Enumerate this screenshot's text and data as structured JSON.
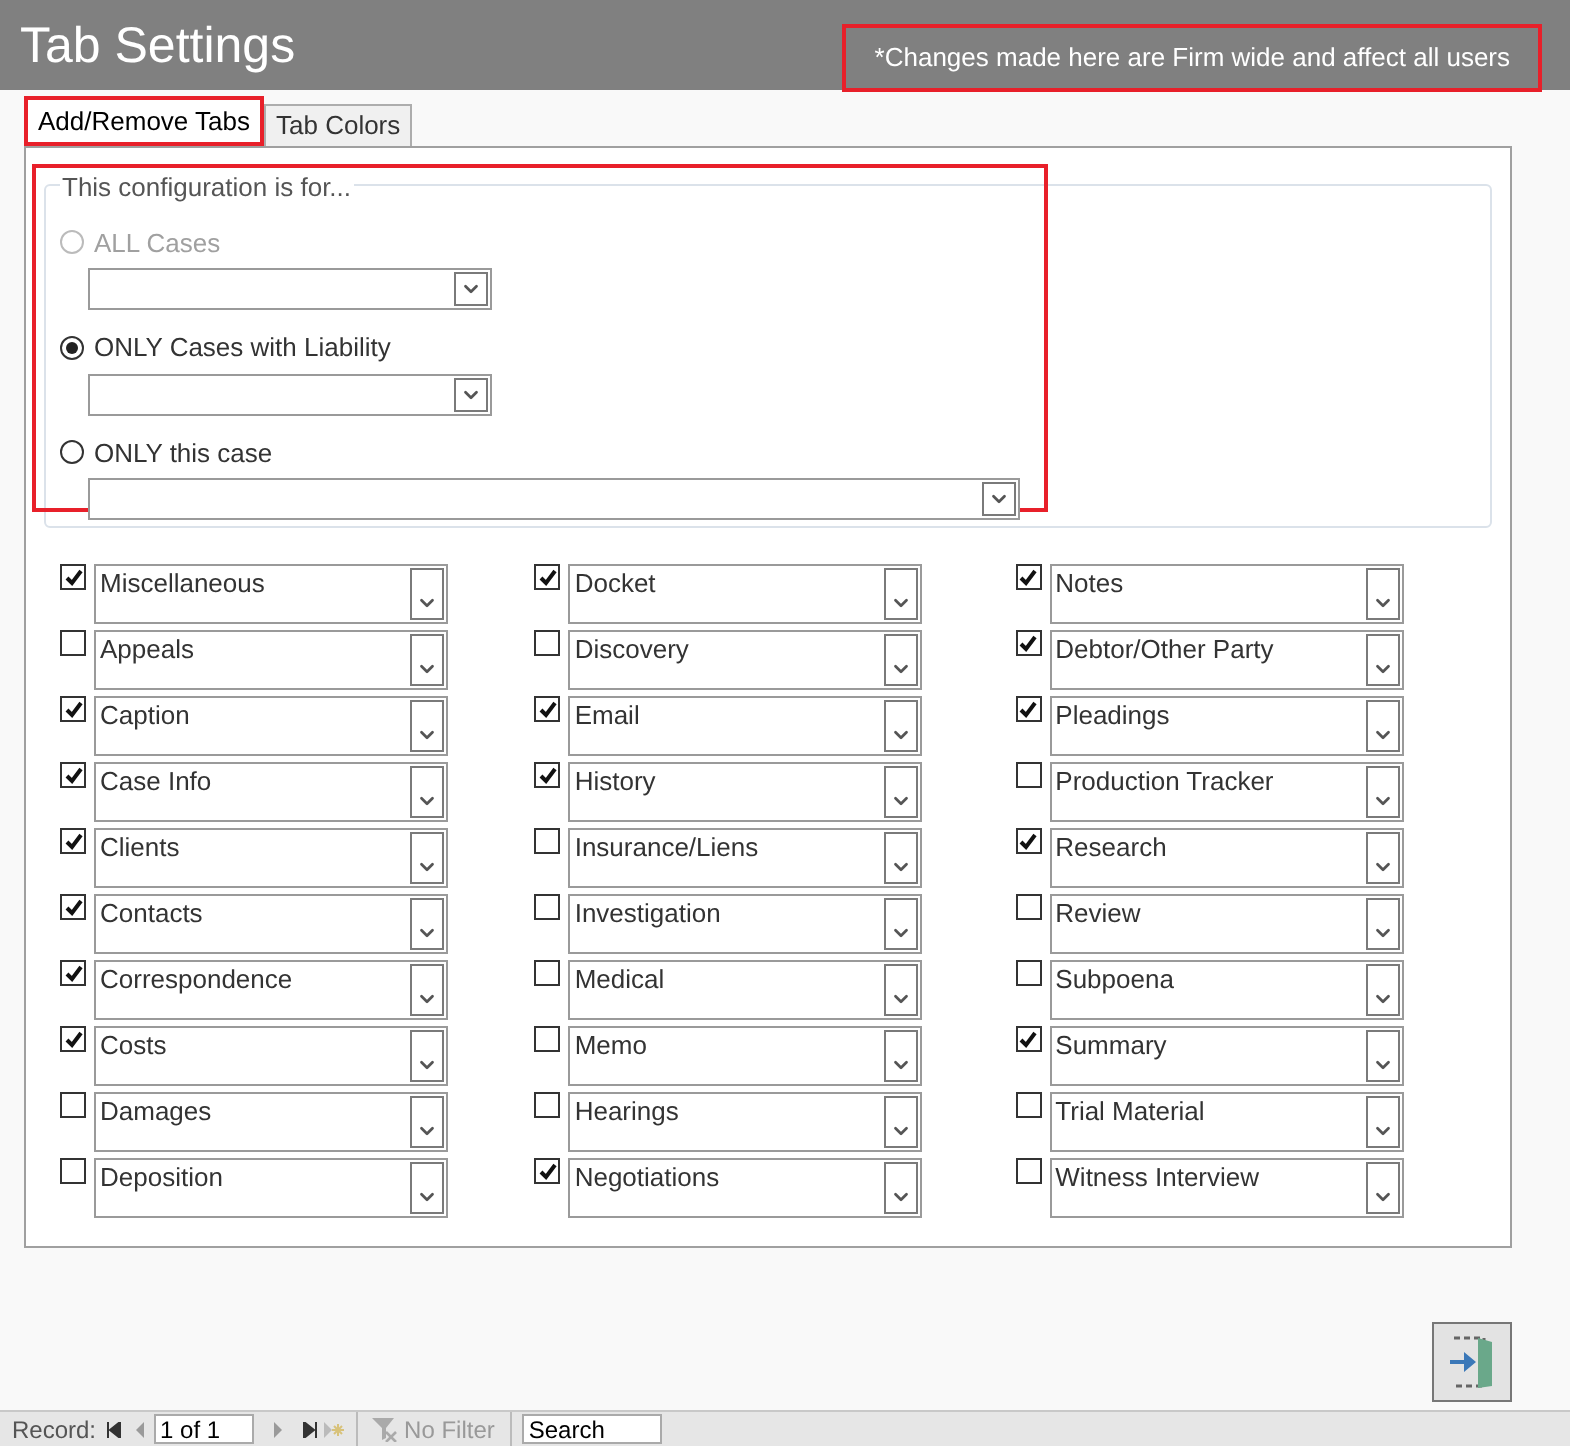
{
  "title": "Tab Settings",
  "notice": {
    "text": "*Changes made here are Firm wide and affect all users",
    "highlighted": true
  },
  "tabs": [
    {
      "label": "Add/Remove Tabs",
      "selected": true,
      "highlighted": true
    },
    {
      "label": "Tab Colors",
      "selected": false,
      "highlighted": false
    }
  ],
  "config": {
    "legend": "This configuration is for...",
    "highlighted": true,
    "options": [
      {
        "label": "ALL Cases",
        "selected": false,
        "disabled": true
      },
      {
        "label": "ONLY Cases with Liability",
        "selected": true,
        "disabled": false
      },
      {
        "label": "ONLY this case",
        "selected": false,
        "disabled": false
      }
    ]
  },
  "tab_columns": [
    [
      {
        "label": "Miscellaneous",
        "checked": true
      },
      {
        "label": "Appeals",
        "checked": false
      },
      {
        "label": "Caption",
        "checked": true
      },
      {
        "label": "Case Info",
        "checked": true
      },
      {
        "label": "Clients",
        "checked": true
      },
      {
        "label": "Contacts",
        "checked": true
      },
      {
        "label": "Correspondence",
        "checked": true
      },
      {
        "label": "Costs",
        "checked": true
      },
      {
        "label": "Damages",
        "checked": false
      },
      {
        "label": "Deposition",
        "checked": false
      }
    ],
    [
      {
        "label": "Docket",
        "checked": true
      },
      {
        "label": "Discovery",
        "checked": false
      },
      {
        "label": "Email",
        "checked": true
      },
      {
        "label": "History",
        "checked": true
      },
      {
        "label": "Insurance/Liens",
        "checked": false
      },
      {
        "label": "Investigation",
        "checked": false
      },
      {
        "label": "Medical",
        "checked": false
      },
      {
        "label": "Memo",
        "checked": false
      },
      {
        "label": "Hearings",
        "checked": false
      },
      {
        "label": "Negotiations",
        "checked": true
      }
    ],
    [
      {
        "label": "Notes",
        "checked": true
      },
      {
        "label": "Debtor/Other Party",
        "checked": true
      },
      {
        "label": "Pleadings",
        "checked": true
      },
      {
        "label": "Production Tracker",
        "checked": false
      },
      {
        "label": "Research",
        "checked": true
      },
      {
        "label": "Review",
        "checked": false
      },
      {
        "label": "Subpoena",
        "checked": false
      },
      {
        "label": "Summary",
        "checked": true
      },
      {
        "label": "Trial Material",
        "checked": false
      },
      {
        "label": "Witness Interview",
        "checked": false
      }
    ]
  ],
  "status_bar": {
    "record_label": "Record:",
    "position": "1 of 1",
    "filter": "No Filter",
    "search": {
      "placeholder": "Search"
    }
  }
}
